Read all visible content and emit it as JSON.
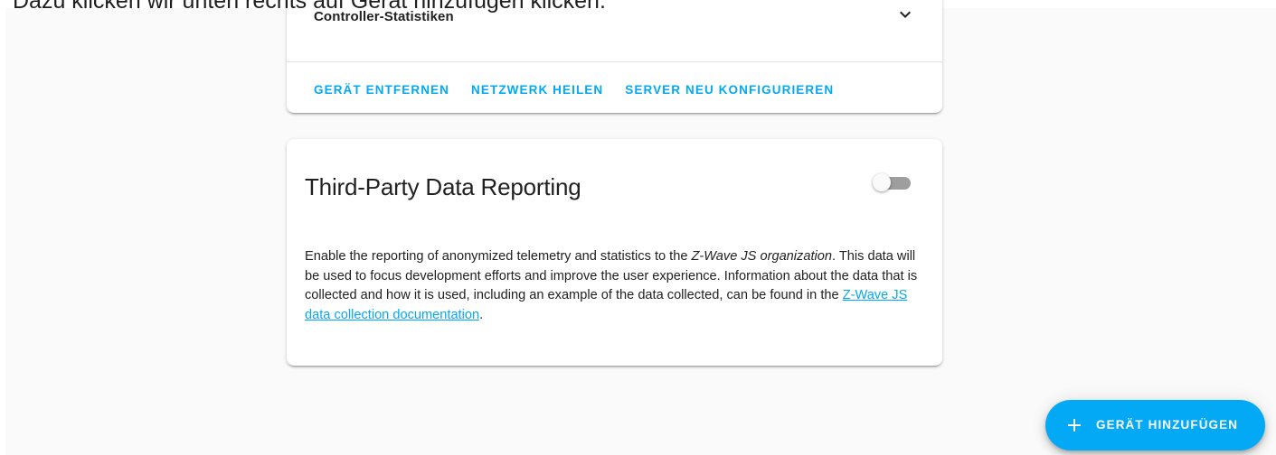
{
  "caption": "Dazu klicken wir unten rechts auf Gerät hinzufügen klicken.",
  "controller_card": {
    "section_title": "Controller-Statistiken",
    "actions": {
      "remove_device": "Gerät entfernen",
      "heal_network": "Netzwerk heilen",
      "reconfigure_server": "Server neu konfigurieren"
    }
  },
  "reporting_card": {
    "title": "Third-Party Data Reporting",
    "toggle_on": false,
    "body_part1": "Enable the reporting of anonymized telemetry and statistics to the ",
    "body_org": "Z-Wave JS organization",
    "body_part2": ". This data will be used to focus development efforts and improve the user experience. Information about the data that is collected and how it is used, including an example of the data collected, can be found in the ",
    "link_text": "Z-Wave JS data collection documentation",
    "body_end": "."
  },
  "fab": {
    "label": "GERÄT HINZUFÜGEN",
    "icon": "plus-icon"
  },
  "colors": {
    "accent": "#03a9f4",
    "text": "#212121",
    "toggle_track_off": "#9e9e9e"
  }
}
